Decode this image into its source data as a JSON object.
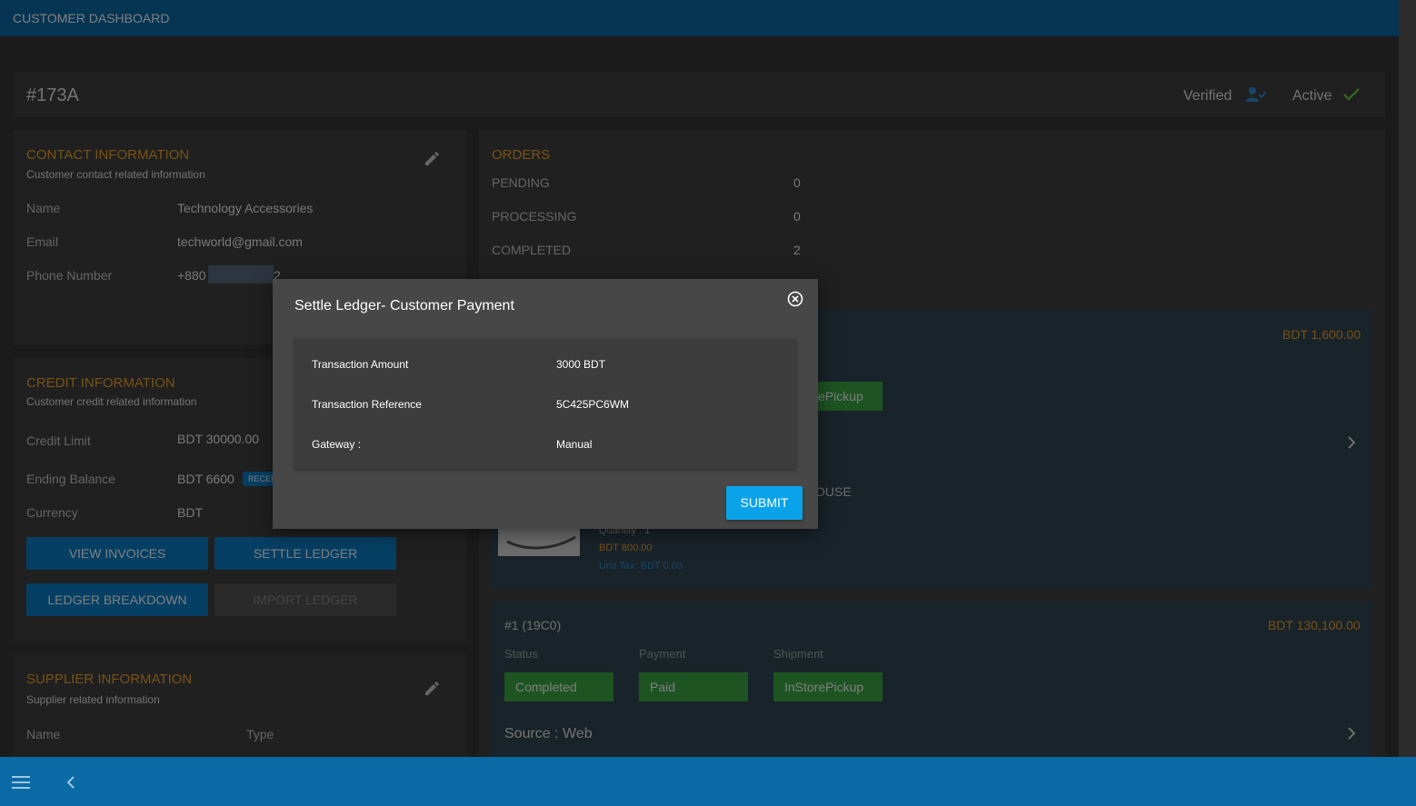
{
  "app": {
    "title": "CUSTOMER DASHBOARD"
  },
  "header": {
    "id": "#173A",
    "verified": "Verified",
    "active": "Active"
  },
  "contact": {
    "title": "CONTACT INFORMATION",
    "subtitle": "Customer contact related information",
    "name_label": "Name",
    "name_value": "Technology Accessories",
    "email_label": "Email",
    "email_value": "techworld@gmail.com",
    "phone_label": "Phone Number",
    "phone_prefix": "+880",
    "phone_suffix": "2"
  },
  "credit": {
    "title": "CREDIT INFORMATION",
    "subtitle": "Customer credit related information",
    "limit_label": "Credit Limit",
    "limit_value": "BDT 30000.00",
    "balance_label": "Ending Balance",
    "balance_value": "BDT 6600",
    "balance_badge": "RECEI",
    "currency_label": "Currency",
    "currency_value": "BDT",
    "view_invoices": "VIEW INVOICES",
    "settle_ledger": "SETTLE LEDGER",
    "ledger_breakdown": "LEDGER BREAKDOWN",
    "import_ledger": "IMPORT LEDGER"
  },
  "supplier": {
    "title": "SUPPLIER INFORMATION",
    "subtitle": "Supplier related information",
    "col_name": "Name",
    "col_type": "Type"
  },
  "orders": {
    "title": "ORDERS",
    "rows": [
      {
        "label": "PENDING",
        "count": "0"
      },
      {
        "label": "PROCESSING",
        "count": "0"
      },
      {
        "label": "COMPLETED",
        "count": "2"
      }
    ],
    "first": {
      "amount": "BDT 1,600.00",
      "shipment_partial": "ePickup",
      "header_partial": "t",
      "warehouse_partial": "OUSE",
      "quantity": "Quantity : 1",
      "price": "BDT 800.00",
      "unit_tax": "Unit Tax: BDT 0.00"
    },
    "second": {
      "id": "#1 (19C0)",
      "amount": "BDT 130,100.00",
      "status_label": "Status",
      "payment_label": "Payment",
      "shipment_label": "Shipment",
      "status": "Completed",
      "payment": "Paid",
      "shipment": "InStorePickup",
      "source": "Source : Web"
    }
  },
  "modal": {
    "title": "Settle Ledger- Customer Payment",
    "rows": [
      {
        "label": "Transaction Amount",
        "value": "3000 BDT"
      },
      {
        "label": "Transaction Reference",
        "value": "5C425PC6WM"
      },
      {
        "label": "Gateway :",
        "value": "Manual"
      }
    ],
    "submit": "SUBMIT"
  },
  "colors": {
    "accent": "#0a7fc9",
    "brand_bar": "#0a6aa6",
    "section_title": "#f0a52b",
    "status_green": "#3aa845"
  }
}
